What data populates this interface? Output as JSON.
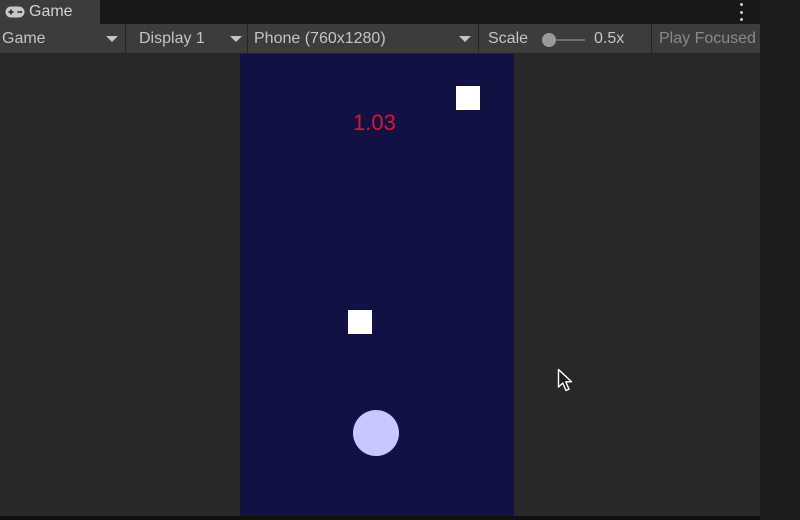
{
  "tab": {
    "title": "Game",
    "icon": "gamepad-icon"
  },
  "toolbar": {
    "mode": "Game",
    "display": "Display 1",
    "resolution": "Phone (760x1280)",
    "scale_label": "Scale",
    "scale_value": "0.5x",
    "play_focused": "Play Focused"
  },
  "game": {
    "score": "1.03",
    "background_color": "#111144",
    "score_color": "#dc1432",
    "player_color": "#c6c8ff",
    "obstacle_color": "#ffffff"
  }
}
